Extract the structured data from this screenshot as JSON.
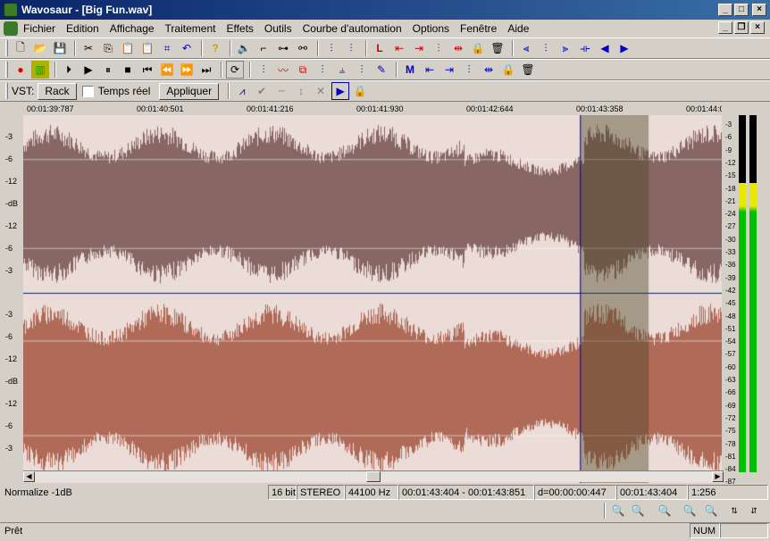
{
  "window": {
    "title": "Wavosaur - [Big Fun.wav]"
  },
  "menu": [
    "Fichier",
    "Edition",
    "Affichage",
    "Traitement",
    "Effets",
    "Outils",
    "Courbe d'automation",
    "Options",
    "Fenêtre",
    "Aide"
  ],
  "vst": {
    "label": "VST:",
    "rack": "Rack",
    "realtime": "Temps réel",
    "apply": "Appliquer"
  },
  "timeline": {
    "ticks": [
      "00:01:39:787",
      "00:01:40:501",
      "00:01:41:216",
      "00:01:41:930",
      "00:01:42:644",
      "00:01:43:358",
      "00:01:44:0"
    ]
  },
  "track_labels": [
    "-3",
    "-6",
    "-12",
    "-dB",
    "-12",
    "-6",
    "-3"
  ],
  "vu_scale": [
    "-3",
    "-6",
    "-9",
    "-12",
    "-15",
    "-18",
    "-21",
    "-24",
    "-27",
    "-30",
    "-33",
    "-36",
    "-39",
    "-42",
    "-45",
    "-48",
    "-51",
    "-54",
    "-57",
    "-60",
    "-63",
    "-66",
    "-69",
    "-72",
    "-75",
    "-78",
    "-81",
    "-84",
    "-87"
  ],
  "vu_levels": {
    "left": 0.81,
    "right": 0.81
  },
  "selection": {
    "start_fraction": 0.795,
    "end_fraction": 0.893
  },
  "scroll": {
    "position": 0.5
  },
  "colors": {
    "wave_top": "#876663",
    "wave_bottom": "#b06a58",
    "bg": "#ecdcd8",
    "selection": "#8c7360",
    "vu_green": "#00c000",
    "vu_yellow": "#e8e800"
  },
  "status": {
    "action": "Normalize -1dB",
    "bits": "16 bit",
    "channels": "STEREO",
    "rate": "44100 Hz",
    "range": "00:01:43:404 - 00:01:43:851",
    "duration": "d=00:00:00:447",
    "cursor": "00:01:43:404",
    "zoom": "1:256",
    "ready": "Prêt",
    "num": "NUM"
  }
}
